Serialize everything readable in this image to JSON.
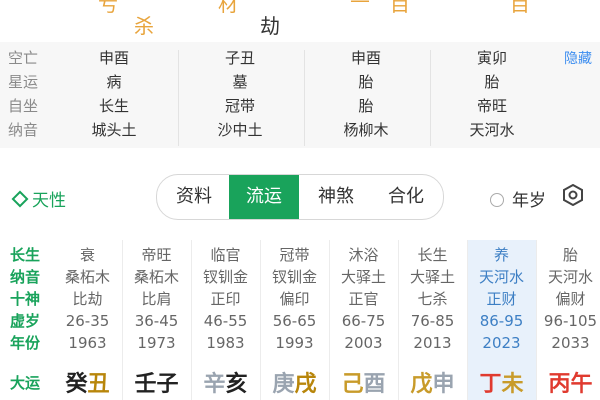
{
  "top_strip": {
    "left_chars": [
      "杀",
      "劫"
    ],
    "colors": {
      "sha": "#e8a43c",
      "jie": "#333333"
    }
  },
  "info": {
    "labels": [
      "空亡",
      "星运",
      "自坐",
      "纳音"
    ],
    "columns": [
      [
        "申酉",
        "病",
        "长生",
        "城头土"
      ],
      [
        "子丑",
        "墓",
        "冠带",
        "沙中土"
      ],
      [
        "申酉",
        "胎",
        "胎",
        "杨柳木"
      ],
      [
        "寅卯",
        "胎",
        "帝旺",
        "天河水"
      ]
    ],
    "hide_label": "隐藏"
  },
  "tabs": {
    "tianxing": "天性",
    "items": [
      "资料",
      "流运",
      "神煞",
      "合化"
    ],
    "active_index": 1,
    "nianshui": "年岁"
  },
  "table": {
    "row_labels": [
      "长生",
      "纳音",
      "十神",
      "虚岁",
      "年份"
    ],
    "dayun_label": "大运",
    "columns": [
      {
        "lines": [
          "衰",
          "桑柘木",
          "比劫",
          "26-35",
          "1963"
        ],
        "dy": [
          "癸",
          "丑"
        ],
        "dy_colors": [
          "#222222",
          "#b8860b"
        ]
      },
      {
        "lines": [
          "帝旺",
          "桑柘木",
          "比肩",
          "36-45",
          "1973"
        ],
        "dy": [
          "壬",
          "子"
        ],
        "dy_colors": [
          "#222222",
          "#222222"
        ]
      },
      {
        "lines": [
          "临官",
          "钗钏金",
          "正印",
          "46-55",
          "1983"
        ],
        "dy": [
          "辛",
          "亥"
        ],
        "dy_colors": [
          "#9aa4b0",
          "#222222"
        ]
      },
      {
        "lines": [
          "冠带",
          "钗钏金",
          "偏印",
          "56-65",
          "1993"
        ],
        "dy": [
          "庚",
          "戌"
        ],
        "dy_colors": [
          "#9aa4b0",
          "#b8860b"
        ]
      },
      {
        "lines": [
          "沐浴",
          "大驿土",
          "正官",
          "66-75",
          "2003"
        ],
        "dy": [
          "己",
          "酉"
        ],
        "dy_colors": [
          "#c89b2a",
          "#9aa4b0"
        ]
      },
      {
        "lines": [
          "长生",
          "大驿土",
          "七杀",
          "76-85",
          "2013"
        ],
        "dy": [
          "戊",
          "申"
        ],
        "dy_colors": [
          "#c89b2a",
          "#9aa4b0"
        ]
      },
      {
        "lines": [
          "养",
          "天河水",
          "正财",
          "86-95",
          "2023"
        ],
        "dy": [
          "丁",
          "未"
        ],
        "dy_colors": [
          "#e03a2f",
          "#c89b2a"
        ],
        "current": true
      },
      {
        "lines": [
          "胎",
          "天河水",
          "偏财",
          "96-105",
          "2033"
        ],
        "dy": [
          "丙",
          "午"
        ],
        "dy_colors": [
          "#e03a2f",
          "#e03a2f"
        ]
      }
    ]
  }
}
